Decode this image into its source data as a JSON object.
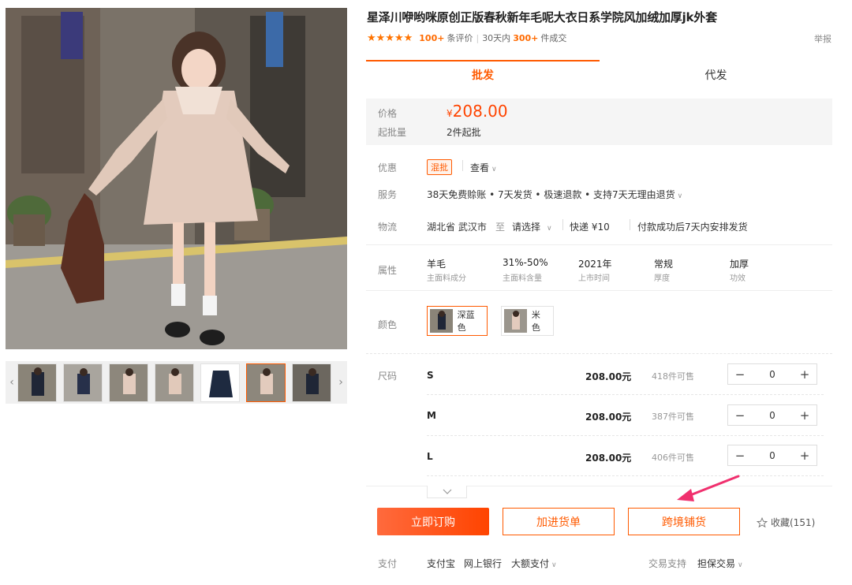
{
  "product": {
    "title": "星泽川咿哟咪原创正版春秋新年毛呢大衣日系学院风加绒加厚jk外套",
    "stars": 5,
    "review_count": "100+",
    "review_label": "条评价",
    "deals_prefix": "30天内",
    "deals_count": "300+",
    "deals_suffix": "件成交",
    "report": "举报"
  },
  "tabs": [
    {
      "label": "批发"
    },
    {
      "label": "代发"
    }
  ],
  "price": {
    "label": "价格",
    "currency": "¥",
    "value": "208.00",
    "moq_label": "起批量",
    "moq_value": "2件起批"
  },
  "promo": {
    "label": "优惠",
    "badge": "混批",
    "link": "查看"
  },
  "service": {
    "label": "服务",
    "text": "38天免费赊账 • 7天发货 • 极速退款 • 支持7天无理由退货"
  },
  "logistics": {
    "label": "物流",
    "origin": "湖北省  武汉市",
    "to": "至",
    "dest": "请选择",
    "express": "快递  ¥10",
    "shipping": "付款成功后7天内安排发货"
  },
  "attributes": {
    "label": "属性",
    "items": [
      {
        "value": "羊毛",
        "key": "主面料成分"
      },
      {
        "value": "31%-50%",
        "key": "主面料含量"
      },
      {
        "value": "2021年",
        "key": "上市时间"
      },
      {
        "value": "常规",
        "key": "厚度"
      },
      {
        "value": "加厚",
        "key": "功效"
      }
    ]
  },
  "colors": {
    "label": "颜色",
    "options": [
      {
        "name": "深蓝色",
        "selected": true
      },
      {
        "name": "米色",
        "selected": false
      }
    ]
  },
  "sizes": {
    "label": "尺码",
    "rows": [
      {
        "name": "S",
        "price": "208.00元",
        "stock": "418件可售",
        "qty": "0"
      },
      {
        "name": "M",
        "price": "208.00元",
        "stock": "387件可售",
        "qty": "0"
      },
      {
        "name": "L",
        "price": "208.00元",
        "stock": "406件可售",
        "qty": "0"
      }
    ]
  },
  "actions": {
    "buy": "立即订购",
    "cart": "加进货单",
    "cross": "跨境铺货",
    "favorite": "收藏(151)"
  },
  "payment": {
    "label": "支付",
    "methods": [
      "支付宝",
      "网上银行",
      "大额支付"
    ],
    "trade_label": "交易支持",
    "trade_value": "担保交易"
  },
  "colors_theme": {
    "accent": "#ff5a00",
    "price": "#ff4400",
    "annotation_arrow": "#f0306e"
  }
}
